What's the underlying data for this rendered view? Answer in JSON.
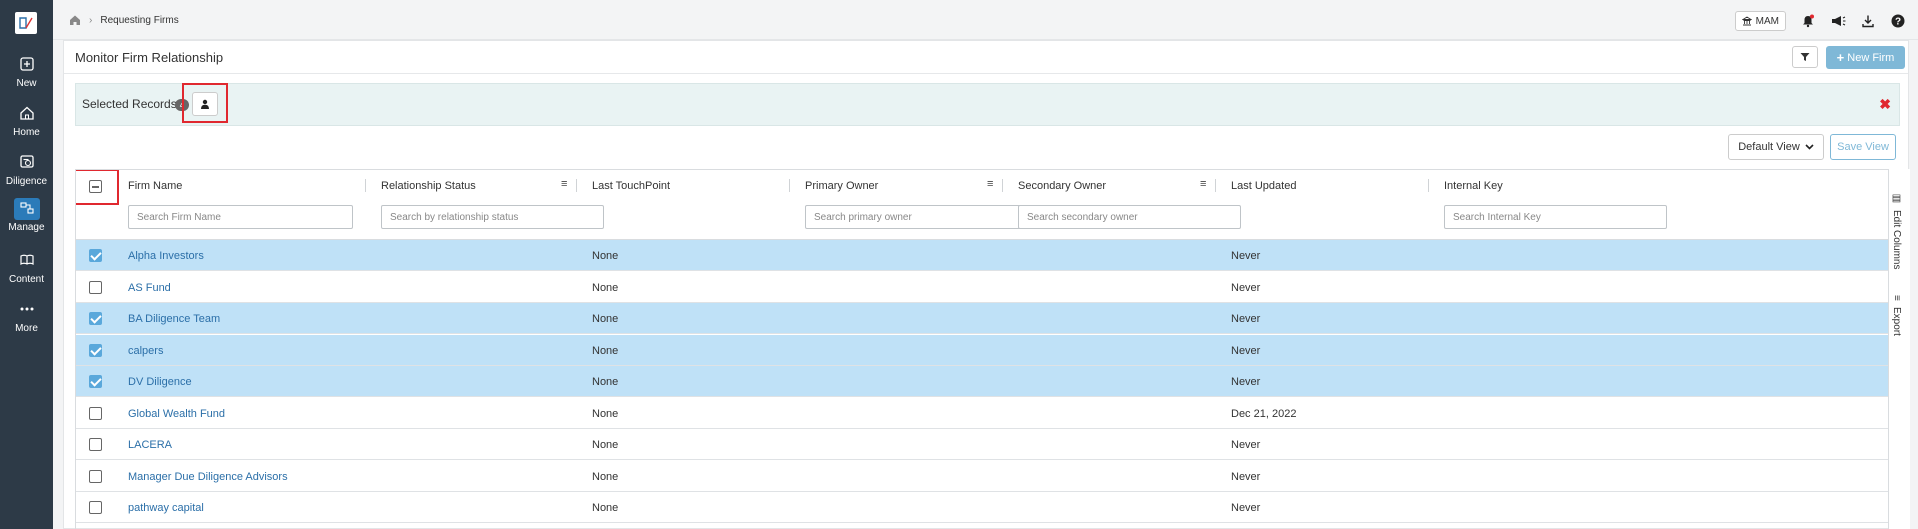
{
  "nav": {
    "items": [
      {
        "label": "New",
        "icon": "plus-square-icon"
      },
      {
        "label": "Home",
        "icon": "home-icon"
      },
      {
        "label": "Diligence",
        "icon": "diligence-icon"
      },
      {
        "label": "Manage",
        "icon": "manage-icon",
        "active": true
      },
      {
        "label": "Content",
        "icon": "book-icon"
      },
      {
        "label": "More",
        "icon": "more-dots-icon"
      }
    ]
  },
  "breadcrumb": {
    "current": "Requesting Firms"
  },
  "topbar": {
    "mam_label": "MAM"
  },
  "page": {
    "title": "Monitor Firm Relationship",
    "new_firm_label": "New Firm"
  },
  "selection": {
    "label": "Selected Records :",
    "count": "4",
    "close_label": "✖"
  },
  "view": {
    "default_label": "Default View",
    "save_label": "Save View"
  },
  "sidetabs": {
    "edit_columns": "Edit Columns",
    "export": "Export"
  },
  "columns": {
    "firm_name": "Firm Name",
    "relationship_status": "Relationship Status",
    "last_touchpoint": "Last TouchPoint",
    "primary_owner": "Primary Owner",
    "secondary_owner": "Secondary Owner",
    "last_updated": "Last Updated",
    "internal_key": "Internal Key"
  },
  "filters": {
    "firm_name": "Search Firm Name",
    "relationship_status": "Search by relationship status",
    "primary_owner": "Search primary owner",
    "secondary_owner": "Search secondary owner",
    "internal_key": "Search Internal Key"
  },
  "rows": [
    {
      "name": "Alpha Investors",
      "touchpoint": "None",
      "updated": "Never",
      "selected": true
    },
    {
      "name": "AS Fund",
      "touchpoint": "None",
      "updated": "Never",
      "selected": false
    },
    {
      "name": "BA Diligence Team",
      "touchpoint": "None",
      "updated": "Never",
      "selected": true
    },
    {
      "name": "calpers",
      "touchpoint": "None",
      "updated": "Never",
      "selected": true
    },
    {
      "name": "DV Diligence",
      "touchpoint": "None",
      "updated": "Never",
      "selected": true
    },
    {
      "name": "Global Wealth Fund",
      "touchpoint": "None",
      "updated": "Dec 21, 2022",
      "selected": false
    },
    {
      "name": "LACERA",
      "touchpoint": "None",
      "updated": "Never",
      "selected": false
    },
    {
      "name": "Manager Due Diligence Advisors",
      "touchpoint": "None",
      "updated": "Never",
      "selected": false
    },
    {
      "name": "pathway capital",
      "touchpoint": "None",
      "updated": "Never",
      "selected": false
    }
  ]
}
